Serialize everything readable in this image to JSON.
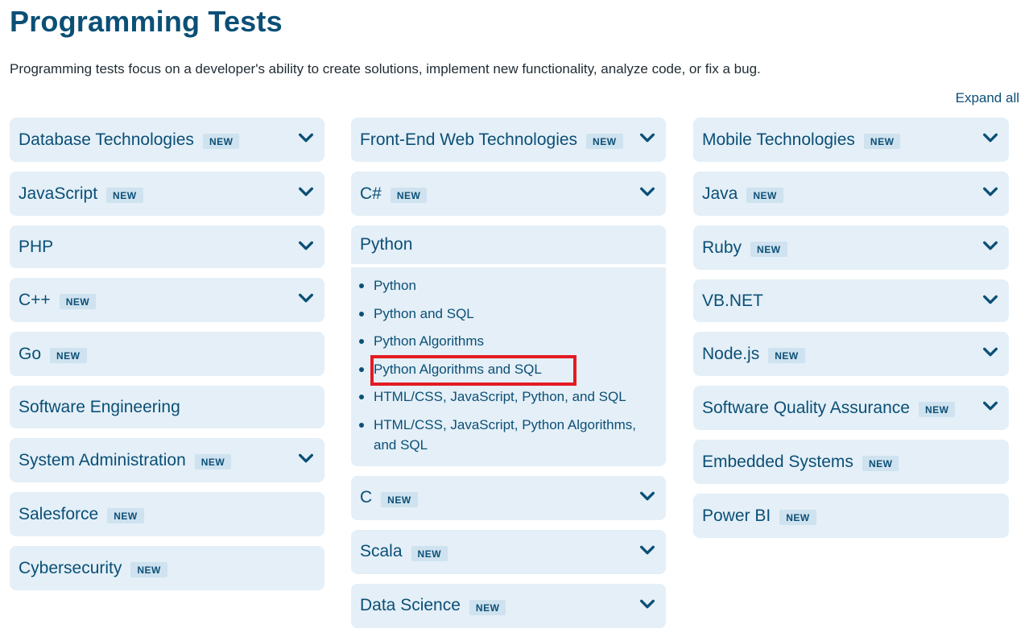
{
  "page": {
    "title": "Programming Tests",
    "intro": "Programming tests focus on a developer's ability to create solutions, implement new functionality, analyze code, or fix a bug.",
    "expand_all": "Expand all"
  },
  "badge_label": "NEW",
  "columns": [
    [
      {
        "title": "Database Technologies",
        "new": true,
        "expandable": true
      },
      {
        "title": "JavaScript",
        "new": true,
        "expandable": true
      },
      {
        "title": "PHP",
        "new": false,
        "expandable": true
      },
      {
        "title": "C++",
        "new": true,
        "expandable": true
      },
      {
        "title": "Go",
        "new": true,
        "expandable": false
      },
      {
        "title": "Software Engineering",
        "new": false,
        "expandable": false
      },
      {
        "title": "System Administration",
        "new": true,
        "expandable": true
      },
      {
        "title": "Salesforce",
        "new": true,
        "expandable": false
      },
      {
        "title": "Cybersecurity",
        "new": true,
        "expandable": false
      }
    ],
    [
      {
        "title": "Front-End Web Technologies",
        "new": true,
        "expandable": true
      },
      {
        "title": "C#",
        "new": true,
        "expandable": true
      },
      {
        "title": "Python",
        "new": false,
        "expanded": true,
        "items": [
          "Python",
          "Python and SQL",
          "Python Algorithms",
          "Python Algorithms and SQL",
          "HTML/CSS, JavaScript, Python, and SQL",
          "HTML/CSS, JavaScript, Python Algorithms, and SQL"
        ],
        "highlighted_item": 3
      },
      {
        "title": "C",
        "new": true,
        "expandable": true
      },
      {
        "title": "Scala",
        "new": true,
        "expandable": true
      },
      {
        "title": "Data Science",
        "new": true,
        "expandable": true
      }
    ],
    [
      {
        "title": "Mobile Technologies",
        "new": true,
        "expandable": true
      },
      {
        "title": "Java",
        "new": true,
        "expandable": true
      },
      {
        "title": "Ruby",
        "new": true,
        "expandable": true
      },
      {
        "title": "VB.NET",
        "new": false,
        "expandable": true
      },
      {
        "title": "Node.js",
        "new": true,
        "expandable": true
      },
      {
        "title": "Software Quality Assurance",
        "new": true,
        "expandable": true
      },
      {
        "title": "Embedded Systems",
        "new": true,
        "expandable": false
      },
      {
        "title": "Power BI",
        "new": true,
        "expandable": false
      }
    ]
  ],
  "colors": {
    "card_bg": "#e4eff7",
    "text": "#0b4f76",
    "badge_bg": "#cfe2ef",
    "highlight": "#e31b23"
  },
  "icons": {
    "expand": "chevron-down-icon",
    "bullet": "bullet-icon"
  }
}
